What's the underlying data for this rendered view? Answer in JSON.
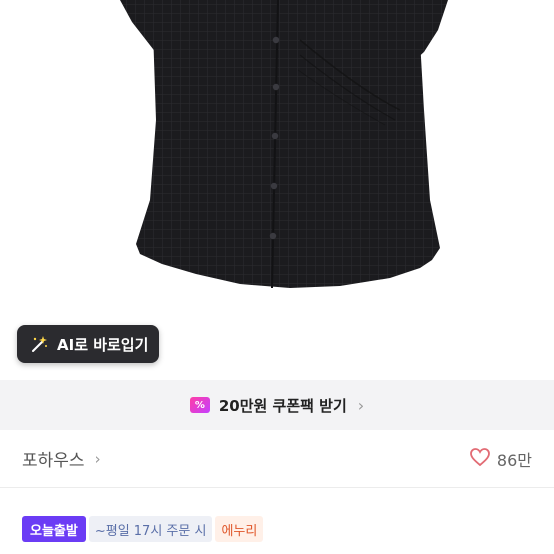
{
  "ai_button": {
    "label": "AI로 바로입기",
    "icon": "magic-wand-icon"
  },
  "coupon": {
    "icon_text": "%",
    "label": "20만원 쿠폰팩 받기",
    "chevron": "›"
  },
  "shop": {
    "name": "포하우스",
    "chevron": "›",
    "like_count": "86만",
    "like_icon": "heart-outline-icon"
  },
  "badges": [
    {
      "label": "오늘출발"
    },
    {
      "label": "~평일 17시 주문 시"
    },
    {
      "label": "에누리"
    }
  ],
  "colors": {
    "badge_today": "#6b3cf5",
    "coupon_gradient_start": "#ff3ea5",
    "coupon_gradient_end": "#c43fff",
    "heart": "#e26b74"
  }
}
